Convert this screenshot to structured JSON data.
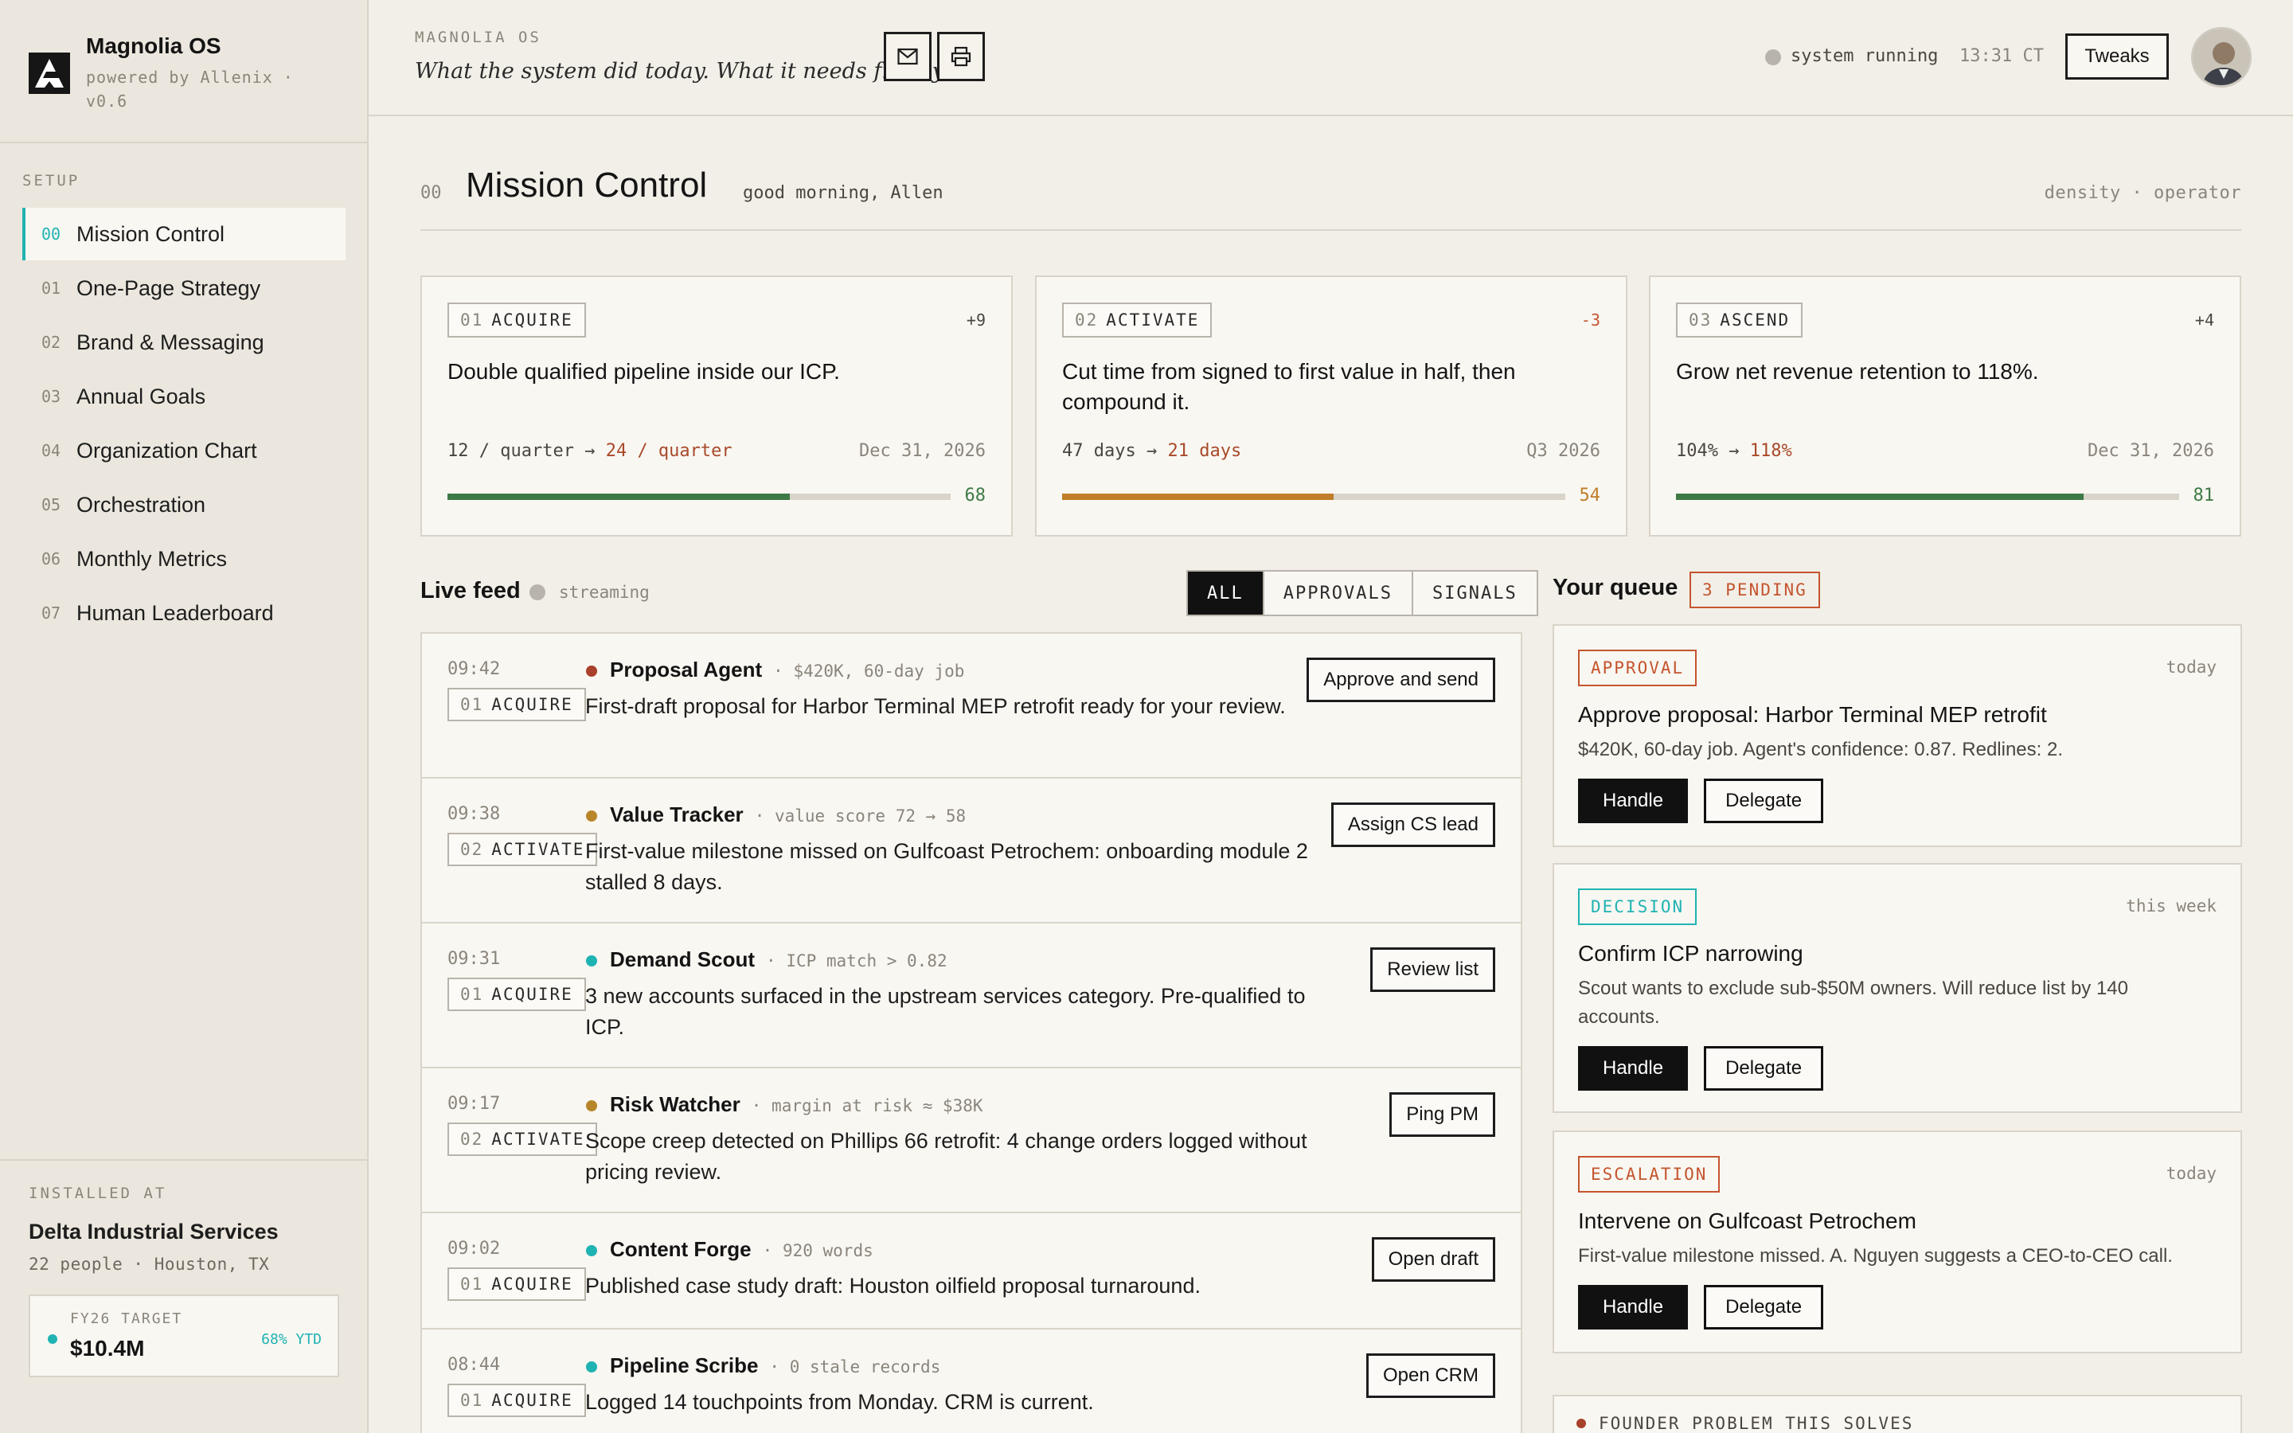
{
  "app": {
    "name": "Magnolia OS",
    "powered_by": "powered by Allenix · v0.6"
  },
  "sidebar": {
    "section_label": "SETUP",
    "items": [
      {
        "num": "00",
        "label": "Mission Control",
        "active": true
      },
      {
        "num": "01",
        "label": "One-Page Strategy"
      },
      {
        "num": "02",
        "label": "Brand & Messaging"
      },
      {
        "num": "03",
        "label": "Annual Goals"
      },
      {
        "num": "04",
        "label": "Organization Chart"
      },
      {
        "num": "05",
        "label": "Orchestration"
      },
      {
        "num": "06",
        "label": "Monthly Metrics"
      },
      {
        "num": "07",
        "label": "Human Leaderboard"
      }
    ],
    "installed_label": "INSTALLED AT",
    "company": "Delta Industrial Services",
    "company_meta": "22 people · Houston, TX",
    "target": {
      "label": "FY26 TARGET",
      "value": "$10.4M",
      "ytd": "68% YTD"
    }
  },
  "header": {
    "os_label": "MAGNOLIA OS",
    "tagline": "What the system did today. What it needs from you.",
    "icons": [
      "mail-icon",
      "print-icon"
    ],
    "status": "system running",
    "time": "13:31 CT",
    "tweaks_label": "Tweaks"
  },
  "page": {
    "num": "00",
    "title": "Mission Control",
    "greeting": "good morning, Allen",
    "density": "density · operator"
  },
  "goals": [
    {
      "num": "01",
      "tag": "ACQUIRE",
      "delta": "+9",
      "delta_color": "#4a463f",
      "text": "Double qualified pipeline inside our ICP.",
      "from": "12 / quarter",
      "to": "24 / quarter",
      "date": "Dec 31, 2026",
      "progress": 68,
      "score": "68",
      "bar_color": "#3e7a45"
    },
    {
      "num": "02",
      "tag": "ACTIVATE",
      "delta": "-3",
      "delta_color": "#c4552e",
      "text": "Cut time from signed to first value in half, then compound it.",
      "from": "47 days",
      "to": "21 days",
      "date": "Q3 2026",
      "progress": 54,
      "score": "54",
      "bar_color": "#c07d2a"
    },
    {
      "num": "03",
      "tag": "ASCEND",
      "delta": "+4",
      "delta_color": "#4a463f",
      "text": "Grow net revenue retention to 118%.",
      "from": "104%",
      "to": "118%",
      "date": "Dec 31, 2026",
      "progress": 81,
      "score": "81",
      "bar_color": "#3e7a45"
    }
  ],
  "feed": {
    "title": "Live feed",
    "status": "streaming",
    "filters": [
      "ALL",
      "APPROVALS",
      "SIGNALS"
    ],
    "rows": [
      {
        "time": "09:42",
        "num": "01",
        "tag": "ACQUIRE",
        "dot": "#a8402a",
        "agent": "Proposal Agent",
        "meta": "· $420K, 60-day job",
        "text": "First-draft proposal for Harbor Terminal MEP retrofit ready for your review.",
        "action": "Approve and send"
      },
      {
        "time": "09:38",
        "num": "02",
        "tag": "ACTIVATE",
        "dot": "#b8862a",
        "agent": "Value Tracker",
        "meta": "· value score 72 → 58",
        "text": "First-value milestone missed on Gulfcoast Petrochem: onboarding module 2 stalled 8 days.",
        "action": "Assign CS lead"
      },
      {
        "time": "09:31",
        "num": "01",
        "tag": "ACQUIRE",
        "dot": "#1fb3b3",
        "agent": "Demand Scout",
        "meta": "· ICP match > 0.82",
        "text": "3 new accounts surfaced in the upstream services category. Pre-qualified to ICP.",
        "action": "Review list"
      },
      {
        "time": "09:17",
        "num": "02",
        "tag": "ACTIVATE",
        "dot": "#b8862a",
        "agent": "Risk Watcher",
        "meta": "· margin at risk ≈ $38K",
        "text": "Scope creep detected on Phillips 66 retrofit: 4 change orders logged without pricing review.",
        "action": "Ping PM"
      },
      {
        "time": "09:02",
        "num": "01",
        "tag": "ACQUIRE",
        "dot": "#1fb3b3",
        "agent": "Content Forge",
        "meta": "· 920 words",
        "text": "Published case study draft: Houston oilfield proposal turnaround.",
        "action": "Open draft"
      },
      {
        "time": "08:44",
        "num": "01",
        "tag": "ACQUIRE",
        "dot": "#1fb3b3",
        "agent": "Pipeline Scribe",
        "meta": "· 0 stale records",
        "text": "Logged 14 touchpoints from Monday. CRM is current.",
        "action": "Open CRM"
      }
    ]
  },
  "queue": {
    "title": "Your queue",
    "pending": "3 PENDING",
    "handle_label": "Handle",
    "delegate_label": "Delegate",
    "cards": [
      {
        "kind": "APPROVAL",
        "kind_color": "#c4552e",
        "when": "today",
        "title": "Approve proposal: Harbor Terminal MEP retrofit",
        "desc": "$420K, 60-day job. Agent's confidence: 0.87. Redlines: 2."
      },
      {
        "kind": "DECISION",
        "kind_color": "#1fb3b3",
        "when": "this week",
        "title": "Confirm ICP narrowing",
        "desc": "Scout wants to exclude sub-$50M owners. Will reduce list by 140 accounts."
      },
      {
        "kind": "ESCALATION",
        "kind_color": "#c4552e",
        "when": "today",
        "title": "Intervene on Gulfcoast Petrochem",
        "desc": "First-value milestone missed. A. Nguyen suggests a CEO-to-CEO call."
      }
    ],
    "founder_label": "FOUNDER PROBLEM THIS SOLVES"
  }
}
